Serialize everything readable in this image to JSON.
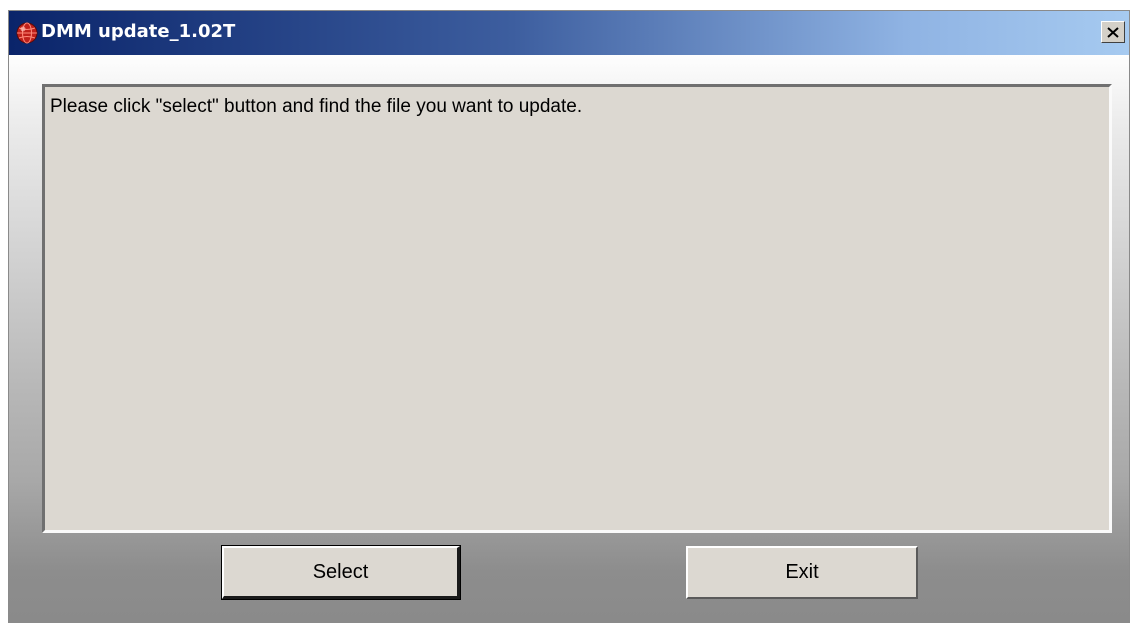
{
  "window": {
    "title": "DMM update_1.02T",
    "app_icon": "red-globe-icon",
    "close_icon": "close-icon"
  },
  "main": {
    "message": "Please click \"select\" button and find the file you want to update."
  },
  "buttons": {
    "select_label": "Select",
    "exit_label": "Exit"
  },
  "colors": {
    "titlebar_start": "#0a246a",
    "titlebar_end": "#a6caf0",
    "panel_bg": "#dcd8d1"
  }
}
